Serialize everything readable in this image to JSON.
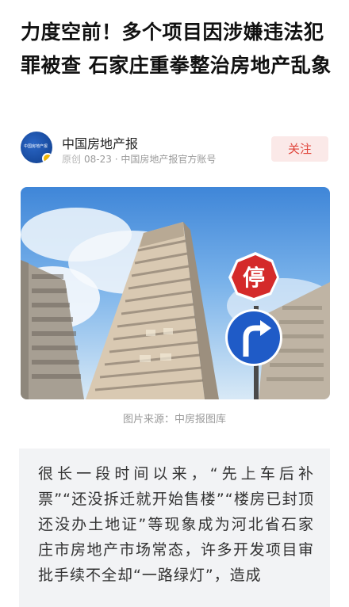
{
  "article": {
    "title": "力度空前！多个项目因涉嫌违法犯罪被查 石家庄重拳整治房地产乱象",
    "author": {
      "name": "中国房地产报",
      "avatar_logo_text": "中国房地产报",
      "tag": "原创",
      "meta": "08-23 · 中国房地产报官方账号",
      "follow_label": "关注"
    },
    "image": {
      "alt_icons": [
        "high-rise-building",
        "stop-sign",
        "turn-right-sign"
      ],
      "stop_sign_text": "停",
      "caption": "图片来源：中房报图库"
    },
    "lead_paragraph": "很长一段时间以来，“先上车后补票”“还没拆迁就开始售楼”“楼房已封顶还没办土地证”等现象成为河北省石家庄市房地产市场常态，许多开发项目审批手续不全却“一路绿灯”，造成"
  },
  "colors": {
    "follow_bg": "#fbe9e8",
    "follow_text": "#e0453b",
    "stop_sign": "#d42a2a",
    "direction_sign": "#1f5bc7",
    "quote_bg": "#f2f3f5"
  }
}
